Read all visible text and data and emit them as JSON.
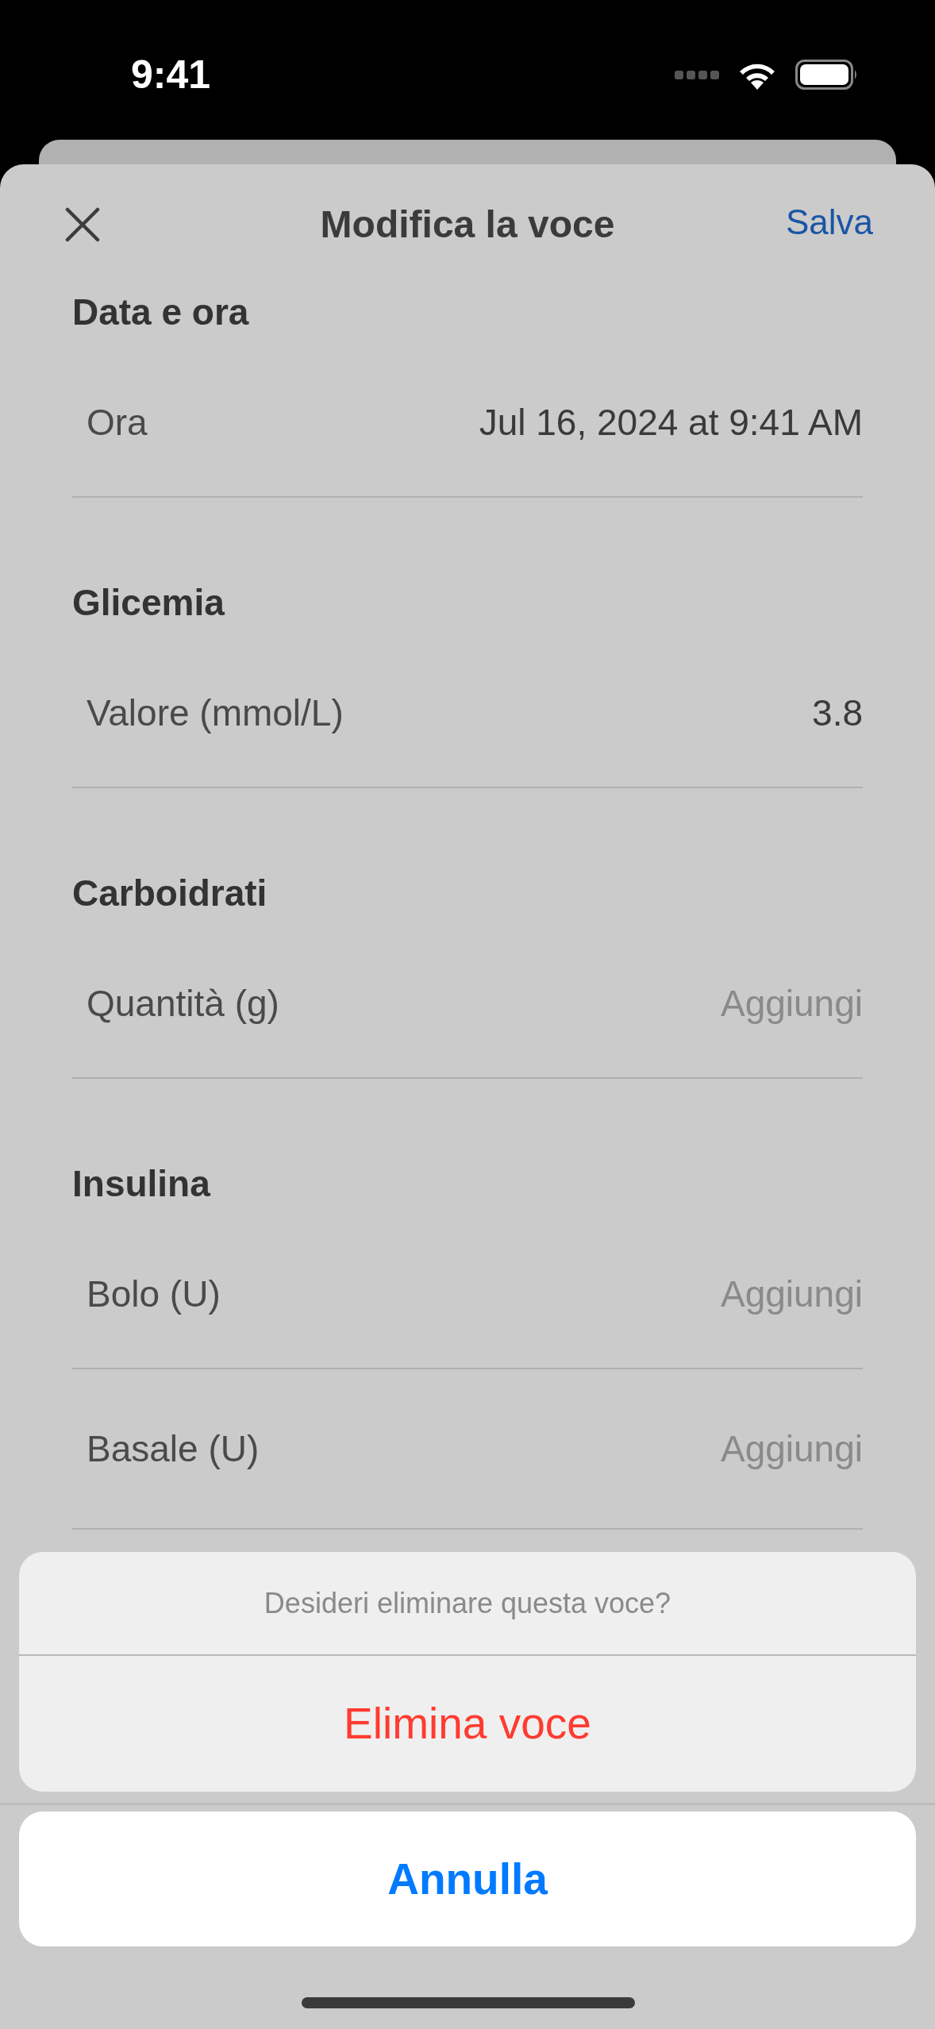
{
  "status_bar": {
    "time": "9:41"
  },
  "header": {
    "title": "Modifica la voce",
    "save": "Salva"
  },
  "sections": [
    {
      "title": "Data e ora",
      "rows": [
        {
          "label": "Ora",
          "value": "Jul 16, 2024 at 9:41 AM"
        }
      ]
    },
    {
      "title": "Glicemia",
      "rows": [
        {
          "label": "Valore (mmol/L)",
          "value": "3.8"
        }
      ]
    },
    {
      "title": "Carboidrati",
      "rows": [
        {
          "label": "Quantità (g)",
          "placeholder": "Aggiungi"
        }
      ]
    },
    {
      "title": "Insulina",
      "rows": [
        {
          "label": "Bolo (U)",
          "placeholder": "Aggiungi"
        },
        {
          "label": "Basale (U)",
          "placeholder": "Aggiungi"
        }
      ]
    }
  ],
  "action_sheet": {
    "message": "Desideri eliminare questa voce?",
    "actions": [
      {
        "label": "Elimina voce",
        "kind": "destructive"
      }
    ],
    "cancel": "Annulla"
  }
}
